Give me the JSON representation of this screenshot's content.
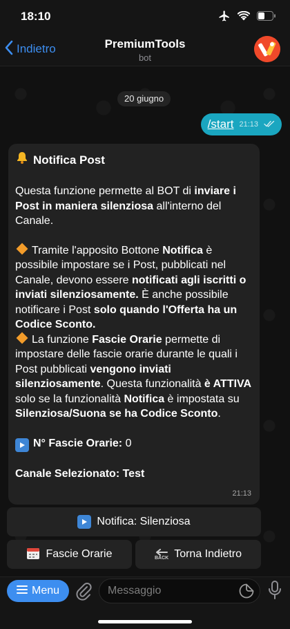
{
  "status_bar": {
    "time": "18:10"
  },
  "header": {
    "back_label": "Indietro",
    "title": "PremiumTools",
    "subtitle": "bot"
  },
  "chat": {
    "date_label": "20 giugno",
    "outgoing": {
      "text": "/start",
      "time": "21:13"
    },
    "incoming": {
      "title": "Notifica Post",
      "p1_a": "Questa funzione permette al BOT di ",
      "p1_b": "inviare i Post in maniera silenziosa",
      "p1_c": " all'interno del Canale.",
      "p2_a": "Tramite l'apposito Bottone ",
      "p2_b": "Notifica",
      "p2_c": " è possibile impostare se i Post, pubblicati nel Canale, devono essere ",
      "p2_d": "notificati agli iscritti o inviati silenziosamente.",
      "p2_e": " È anche possibile notificare i Post ",
      "p2_f": "solo quando l'Offerta ha un Codice Sconto.",
      "p3_a": "La funzione ",
      "p3_b": "Fascie Orarie",
      "p3_c": " permette di impostare delle fascie orarie durante le quali i Post pubblicati ",
      "p3_d": "vengono inviati silenziosamente",
      "p3_e": ". Questa funzionalità ",
      "p3_f": "è ATTIVA",
      "p3_g": " solo se la funzionalità ",
      "p3_h": "Notifica",
      "p3_i": " è impostata su ",
      "p3_j": "Silenziosa/Suona se ha Codice Sconto",
      "p3_k": ".",
      "count_label": "N° Fascie Orarie:",
      "count_value": " 0",
      "channel": "Canale Selezionato: Test",
      "time": "21:13"
    }
  },
  "keyboard": {
    "notify_label": "Notifica: Silenziosa",
    "slots_label": "Fascie Orarie",
    "back_label": "Torna Indietro",
    "back_icon_text": "BACK"
  },
  "input_bar": {
    "menu_label": "Menu",
    "placeholder": "Messaggio"
  },
  "colors": {
    "accent": "#3d8ef0",
    "outgoing_bubble": "#1aa6c0",
    "incoming_bubble": "#222222",
    "avatar": "#f0492a"
  }
}
